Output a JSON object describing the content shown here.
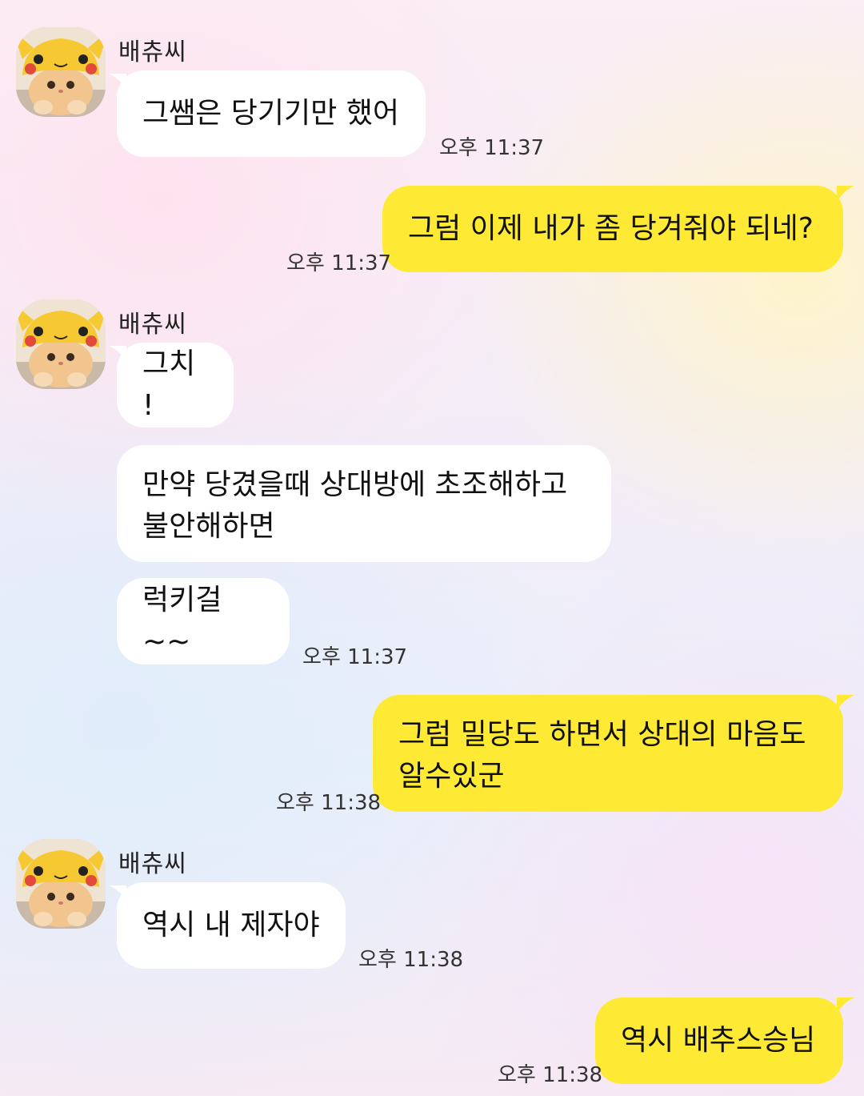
{
  "sender": {
    "name": "배츄씨"
  },
  "avatar_icon": "pikachu-hat-cat-avatar",
  "colors": {
    "incoming_bubble": "#ffffff",
    "outgoing_bubble": "#fee934"
  },
  "messages": [
    {
      "from": "other",
      "text": "그쌤은 당기기만 했어",
      "time": "오후 11:37"
    },
    {
      "from": "me",
      "text": "그럼 이제 내가 좀 당겨줘야 되네?",
      "time": "오후 11:37"
    },
    {
      "from": "other",
      "text": "그치 !"
    },
    {
      "from": "other",
      "lines": [
        "만약 당겼을때 상대방에 초조해하고",
        "불안해하면"
      ]
    },
    {
      "from": "other",
      "text": "럭키걸~~",
      "time": "오후 11:37"
    },
    {
      "from": "me",
      "lines": [
        "그럼 밀당도 하면서 상대의 마음도",
        "알수있군"
      ],
      "time": "오후 11:38"
    },
    {
      "from": "other",
      "text": "역시 내 제자야",
      "time": "오후 11:38"
    },
    {
      "from": "me",
      "text": "역시 배추스승님",
      "time": "오후 11:38"
    }
  ]
}
